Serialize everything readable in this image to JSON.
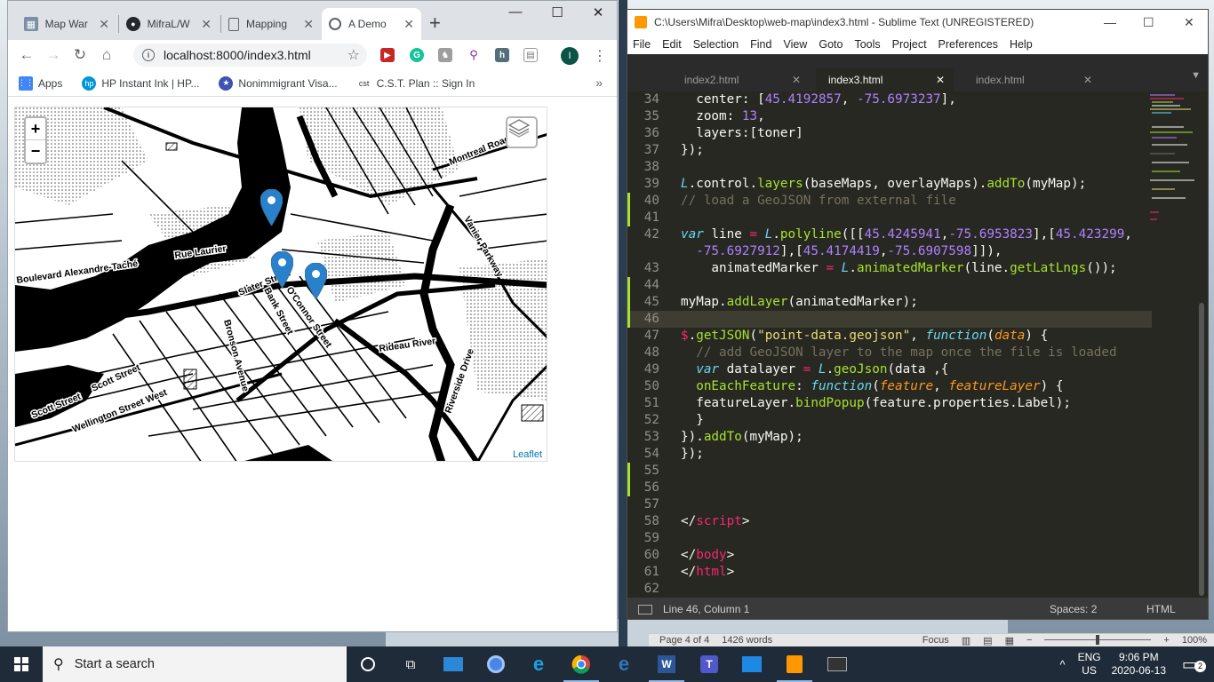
{
  "chrome": {
    "tabs": [
      {
        "title": "Map War",
        "icon": "map-icon"
      },
      {
        "title": "MifraL/W",
        "icon": "github-icon"
      },
      {
        "title": "Mapping",
        "icon": "doc-icon"
      },
      {
        "title": "A Demo",
        "icon": "globe-icon",
        "active": true
      }
    ],
    "url": "localhost:8000/index3.html",
    "profile_initial": "I",
    "bookmarks": [
      {
        "label": "Apps",
        "icon": "apps-grid-icon"
      },
      {
        "label": "HP Instant Ink | HP...",
        "icon": "hp-icon"
      },
      {
        "label": "Nonimmigrant Visa...",
        "icon": "seal-icon"
      },
      {
        "label": "C.S.T. Plan :: Sign In",
        "icon": "cst-icon"
      }
    ]
  },
  "map": {
    "street_labels": [
      "Montreal Road",
      "Rue Laurier",
      "Boulevard Alexandre-Taché",
      "Vanier Parkway",
      "Slater Street",
      "Bank Street",
      "O'Connor Street",
      "Bronson Avenue",
      "Rideau River",
      "Riverside Drive",
      "Scott Street",
      "Wellington Street West"
    ],
    "zoom_in": "+",
    "zoom_out": "−",
    "attribution": "Leaflet"
  },
  "sublime": {
    "title": "C:\\Users\\Mifra\\Desktop\\web-map\\index3.html - Sublime Text (UNREGISTERED)",
    "menu": [
      "File",
      "Edit",
      "Selection",
      "Find",
      "View",
      "Goto",
      "Tools",
      "Project",
      "Preferences",
      "Help"
    ],
    "tabs": [
      "index2.html",
      "index3.html",
      "index.html"
    ],
    "active_tab": "index3.html",
    "status_left": "Line 46, Column 1",
    "status_spaces": "Spaces: 2",
    "status_syntax": "HTML",
    "line_numbers": [
      "34",
      "35",
      "36",
      "37",
      "38",
      "39",
      "40",
      "41",
      "42",
      "",
      "43",
      "44",
      "45",
      "46",
      "47",
      "48",
      "49",
      "50",
      "51",
      "52",
      "53",
      "54",
      "55",
      "56",
      "57",
      "58",
      "59",
      "60",
      "61",
      "62"
    ]
  },
  "word_status": {
    "page": "Page 4 of 4",
    "words": "1426 words",
    "focus": "Focus",
    "zoom": "100%"
  },
  "taskbar": {
    "search_placeholder": "Start a search",
    "lang_top": "ENG",
    "lang_bottom": "US",
    "time": "9:06 PM",
    "date": "2020-06-13",
    "notifications": "2"
  }
}
